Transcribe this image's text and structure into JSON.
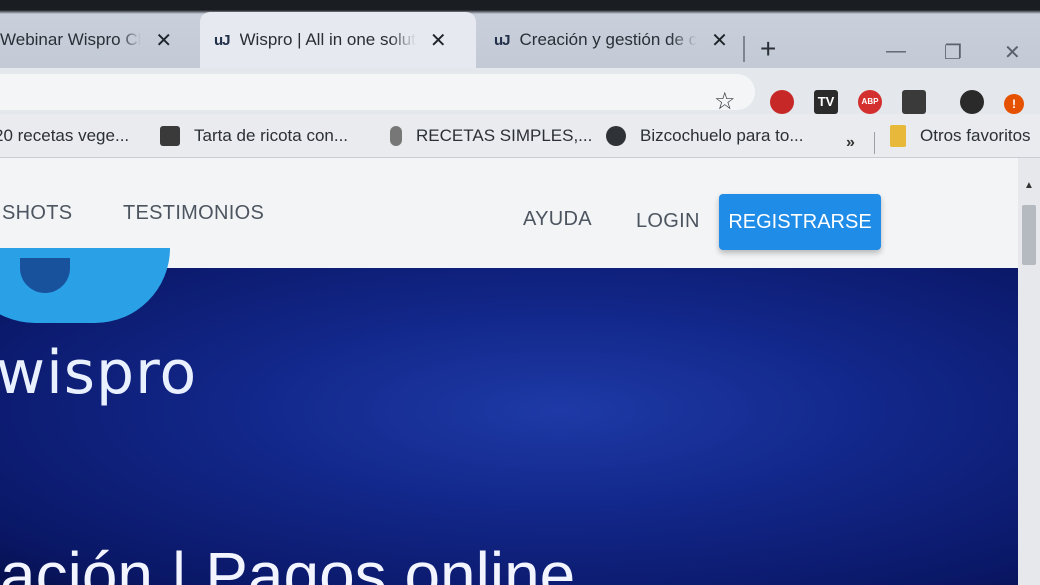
{
  "tabs": [
    {
      "title": "Webinar Wispro Cl",
      "icon": "",
      "active": false
    },
    {
      "title": "Wispro | All in one solut",
      "icon": "uJ",
      "active": true
    },
    {
      "title": "Creación y gestión de c",
      "icon": "uJ",
      "active": false
    }
  ],
  "newtab_symbol": "+",
  "window_controls": {
    "minimize": "—",
    "maximize": "❐",
    "close": "✕"
  },
  "toolbar": {
    "star": "☆"
  },
  "extensions": [
    {
      "name": "ublock-icon",
      "label": "",
      "color": "#c62828"
    },
    {
      "name": "tv-icon",
      "label": "TV",
      "color": "#2b2b2b"
    },
    {
      "name": "adblock-icon",
      "label": "ABP",
      "color": "#d32f2f"
    },
    {
      "name": "extension-icon",
      "label": "",
      "color": "#3a3a3a"
    },
    {
      "name": "profile-icon",
      "label": "",
      "color": "#2a2a2a"
    },
    {
      "name": "update-icon",
      "label": "!",
      "color": "#e65100"
    }
  ],
  "bookmarks": [
    {
      "label": "20 recetas vege..."
    },
    {
      "label": "Tarta de ricota con..."
    },
    {
      "label": "RECETAS SIMPLES,..."
    },
    {
      "label": "Bizcochuelo para to..."
    }
  ],
  "bookmarks_more": "»",
  "bookmarks_other": "Otros favoritos",
  "nav": {
    "items": [
      "SHOTS",
      "TESTIMONIOS",
      "AYUDA",
      "LOGIN"
    ],
    "register": "REGISTRARSE"
  },
  "hero": {
    "logo_text": "wispro",
    "headline": "ación | Pagos online"
  },
  "colors": {
    "hero_bg": "#0d1e6a",
    "register_bg": "#1f8ce8",
    "logo_blue": "#2aa0e6"
  }
}
